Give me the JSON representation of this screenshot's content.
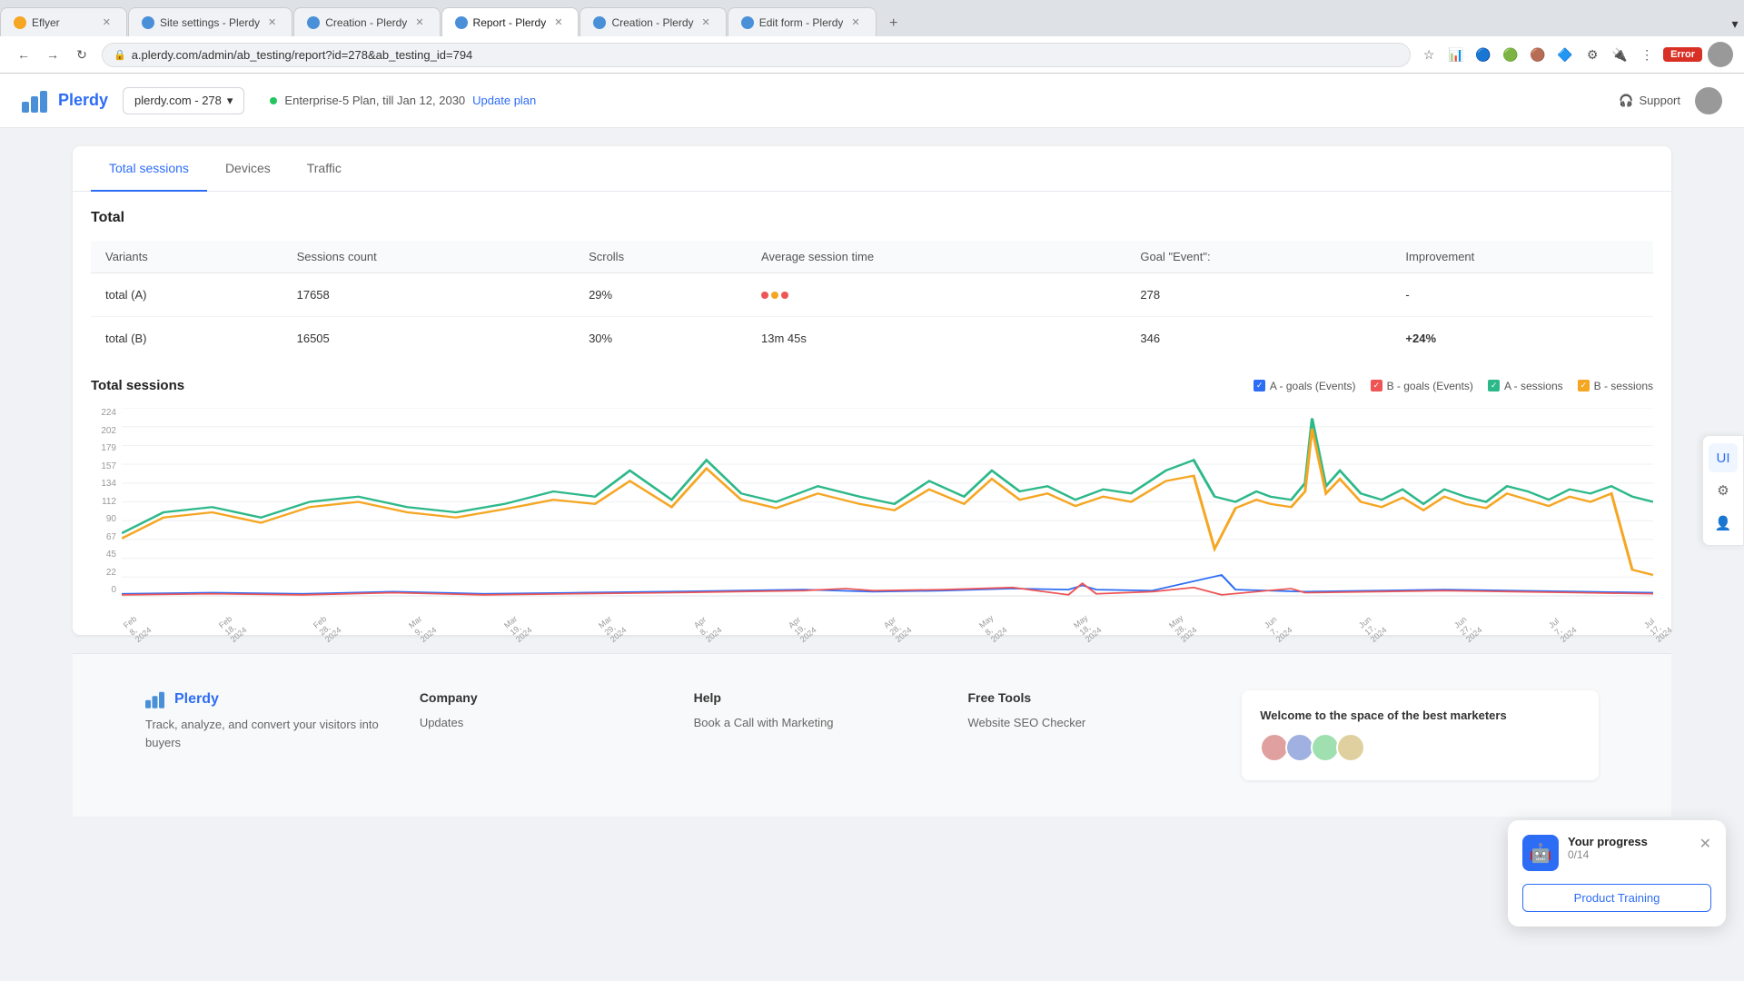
{
  "browser": {
    "tabs": [
      {
        "id": "tab1",
        "icon_color": "#f5a623",
        "title": "Eflyer",
        "active": false
      },
      {
        "id": "tab2",
        "icon_color": "#4a90d9",
        "title": "Site settings - Plerdy",
        "active": false
      },
      {
        "id": "tab3",
        "icon_color": "#4a90d9",
        "title": "Creation - Plerdy",
        "active": false
      },
      {
        "id": "tab4",
        "icon_color": "#4a90d9",
        "title": "Report - Plerdy",
        "active": true
      },
      {
        "id": "tab5",
        "icon_color": "#4a90d9",
        "title": "Creation - Plerdy",
        "active": false
      },
      {
        "id": "tab6",
        "icon_color": "#4a90d9",
        "title": "Edit form - Plerdy",
        "active": false
      }
    ],
    "url": "a.plerdy.com/admin/ab_testing/report?id=278&ab_testing_id=794",
    "error_label": "Error"
  },
  "header": {
    "logo_text": "Plerdy",
    "site_selector": "plerdy.com - 278",
    "plan_text": "Enterprise-5 Plan, till Jan 12, 2030",
    "update_plan": "Update plan",
    "support": "Support"
  },
  "tabs": [
    {
      "id": "total-sessions",
      "label": "Total sessions",
      "active": true
    },
    {
      "id": "devices",
      "label": "Devices",
      "active": false
    },
    {
      "id": "traffic",
      "label": "Traffic",
      "active": false
    }
  ],
  "table": {
    "title": "Total",
    "headers": [
      "Variants",
      "Sessions count",
      "Scrolls",
      "Average session time",
      "Goal \"Event\":",
      "Improvement"
    ],
    "rows": [
      {
        "variant": "total (A)",
        "sessions": "17658",
        "scrolls": "29%",
        "avg_time": "dots",
        "goal": "278",
        "improvement": "-"
      },
      {
        "variant": "total (B)",
        "sessions": "16505",
        "scrolls": "30%",
        "avg_time": "13m 45s",
        "goal": "346",
        "improvement": "+24%"
      }
    ]
  },
  "chart": {
    "title": "Total sessions",
    "legend": [
      {
        "id": "a-goals",
        "label": "A - goals (Events)",
        "color": "#2d6df6",
        "type": "checkbox"
      },
      {
        "id": "b-goals",
        "label": "B - goals (Events)",
        "color": "#e55",
        "type": "checkbox"
      },
      {
        "id": "a-sessions",
        "label": "A - sessions",
        "color": "#2db88a",
        "type": "checkbox"
      },
      {
        "id": "b-sessions",
        "label": "B - sessions",
        "color": "#f5a623",
        "type": "checkbox"
      }
    ],
    "y_labels": [
      "224",
      "202",
      "179",
      "157",
      "134",
      "112",
      "90",
      "67",
      "45",
      "22",
      "0"
    ],
    "x_labels": [
      "Feb 8, 2024",
      "Feb 18, 2024",
      "Feb 28, 2024",
      "Mar 9, 2024",
      "Mar 19, 2024",
      "Mar 29, 2024",
      "Apr 8, 2024",
      "Apr 19, 2024",
      "Apr 28, 2024",
      "May 8, 2024",
      "May 18, 2024",
      "May 28, 2024",
      "Jun 7, 2024",
      "Jun 17, 2024",
      "Jun 27, 2024",
      "Jul 7, 2024",
      "Jul 17, 2024"
    ]
  },
  "right_sidebar": {
    "icons": [
      "UI",
      "⚙",
      "👤"
    ]
  },
  "progress_widget": {
    "title": "Your progress",
    "score": "0/14",
    "button_label": "Product Training"
  },
  "footer": {
    "brand_text": "Track, analyze, and convert your visitors into buyers",
    "company": {
      "title": "Company",
      "links": [
        "Updates"
      ]
    },
    "help": {
      "title": "Help",
      "links": [
        "Book a Call with Marketing"
      ]
    },
    "free_tools": {
      "title": "Free Tools",
      "links": [
        "Website SEO Checker"
      ]
    },
    "welcome": {
      "title": "Welcome to the space of the best marketers"
    }
  }
}
